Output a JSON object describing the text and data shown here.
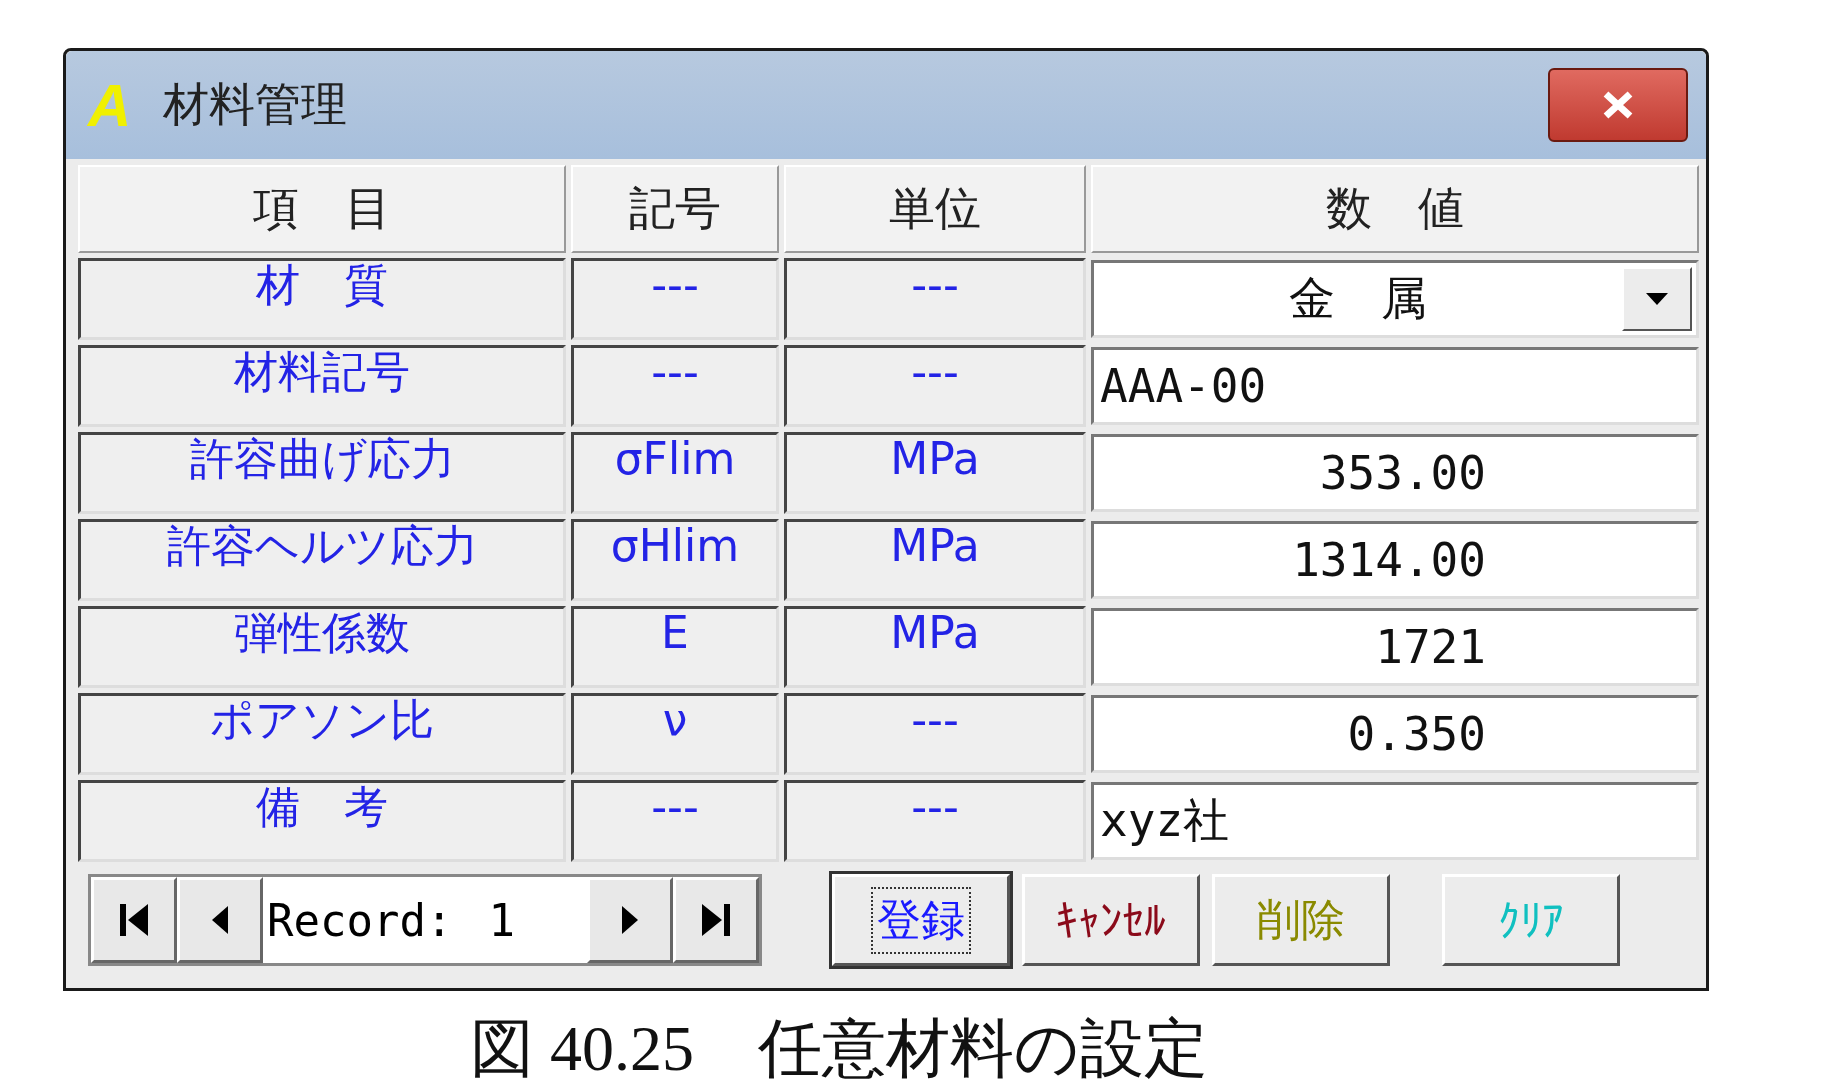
{
  "window": {
    "icon_letter": "A",
    "title": "材料管理"
  },
  "columns": [
    "項　目",
    "記号",
    "単位",
    "数　値"
  ],
  "rows": [
    {
      "item": "材　質",
      "symbol": "---",
      "unit": "---",
      "value": "金　属",
      "kind": "dropdown"
    },
    {
      "item": "材料記号",
      "symbol": "---",
      "unit": "---",
      "value": "AAA-00",
      "kind": "text"
    },
    {
      "item": "許容曲げ応力",
      "symbol": "σFlim",
      "unit": "MPa",
      "value": "353.00",
      "kind": "number"
    },
    {
      "item": "許容ヘルツ応力",
      "symbol": "σHlim",
      "unit": "MPa",
      "value": "1314.00",
      "kind": "number"
    },
    {
      "item": "弾性係数",
      "symbol": "E",
      "unit": "MPa",
      "value": "1721",
      "kind": "number"
    },
    {
      "item": "ポアソン比",
      "symbol": "ν",
      "unit": "---",
      "value": "0.350",
      "kind": "number"
    },
    {
      "item": "備　考",
      "symbol": "---",
      "unit": "---",
      "value": "xyz社",
      "kind": "text"
    }
  ],
  "navigator": {
    "label": "Record:",
    "number": "1"
  },
  "buttons": [
    {
      "label": "登録",
      "color": "#1a1aff",
      "focused": true
    },
    {
      "label": "ｷｬﾝｾﾙ",
      "color": "#8b0a1a",
      "focused": false
    },
    {
      "label": "削除",
      "color": "#8a8a00",
      "focused": false
    },
    {
      "label": "ｸﾘｱ",
      "color": "#10c0c0",
      "focused": false
    }
  ],
  "caption": "図 40.25　任意材料の設定"
}
